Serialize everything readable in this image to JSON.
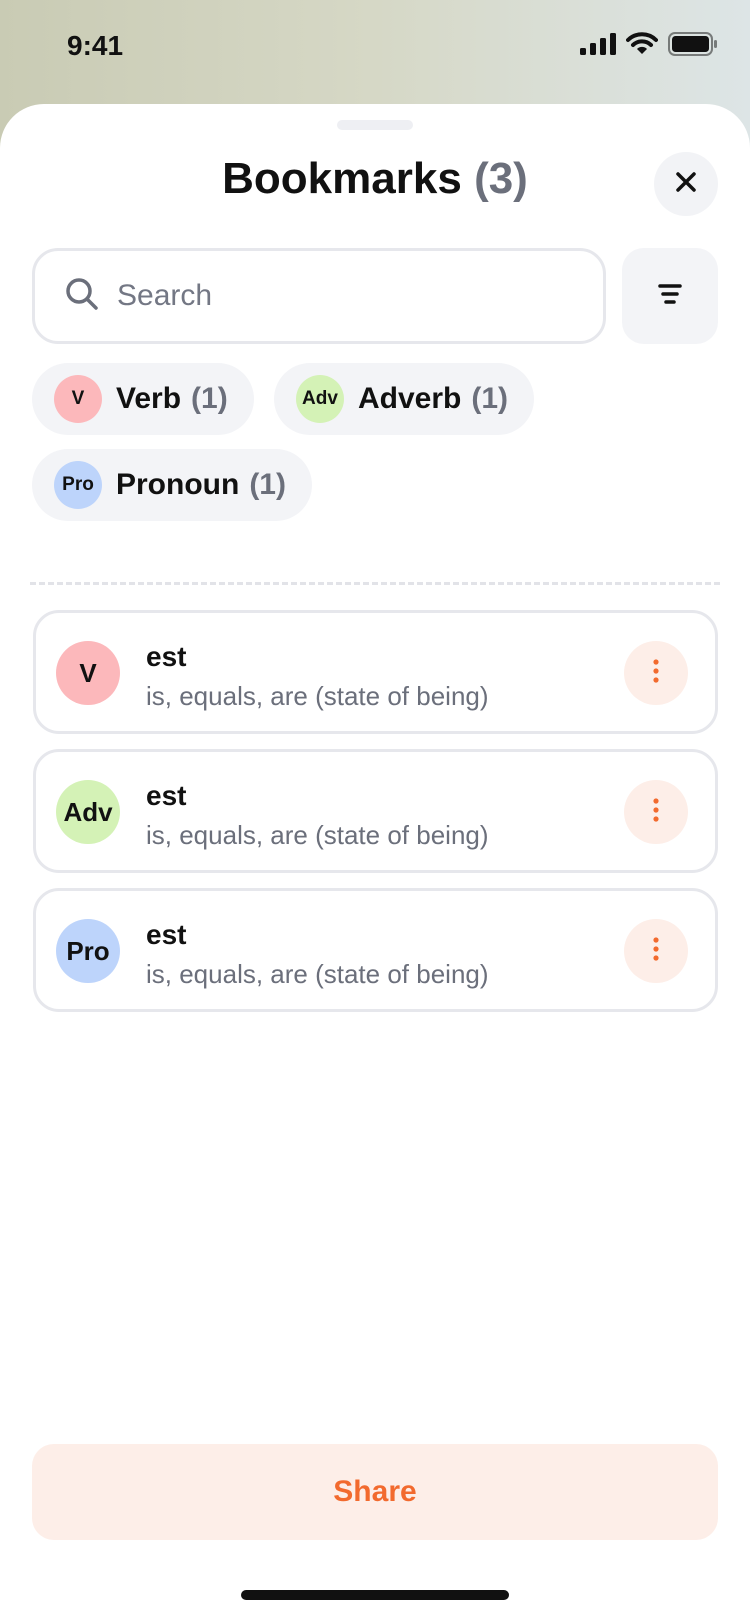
{
  "status_bar": {
    "time": "9:41"
  },
  "header": {
    "title": "Bookmarks",
    "count": "(3)"
  },
  "search": {
    "placeholder": "Search",
    "value": ""
  },
  "chips": [
    {
      "badge": "V",
      "label": "Verb",
      "count": "(1)",
      "color": "#fcb8bb"
    },
    {
      "badge": "Adv",
      "label": "Adverb",
      "count": "(1)",
      "color": "#d4f2b6"
    },
    {
      "badge": "Pro",
      "label": "Pronoun",
      "count": "(1)",
      "color": "#bdd4fb"
    }
  ],
  "items": [
    {
      "badge": "V",
      "word": "est",
      "definition": "is, equals, are (state of being)",
      "color": "#fcb8bb"
    },
    {
      "badge": "Adv",
      "word": "est",
      "definition": "is, equals, are (state of being)",
      "color": "#d4f2b6"
    },
    {
      "badge": "Pro",
      "word": "est",
      "definition": "is, equals, are (state of being)",
      "color": "#bdd4fb"
    }
  ],
  "footer": {
    "share_label": "Share"
  },
  "colors": {
    "accent": "#f26a2e",
    "accent_bg": "#fdeee8",
    "muted_text": "#6b6f7b"
  },
  "icons": [
    "signal-icon",
    "wifi-icon",
    "battery-icon",
    "close-icon",
    "search-icon",
    "filter-icon",
    "more-vertical-icon"
  ]
}
